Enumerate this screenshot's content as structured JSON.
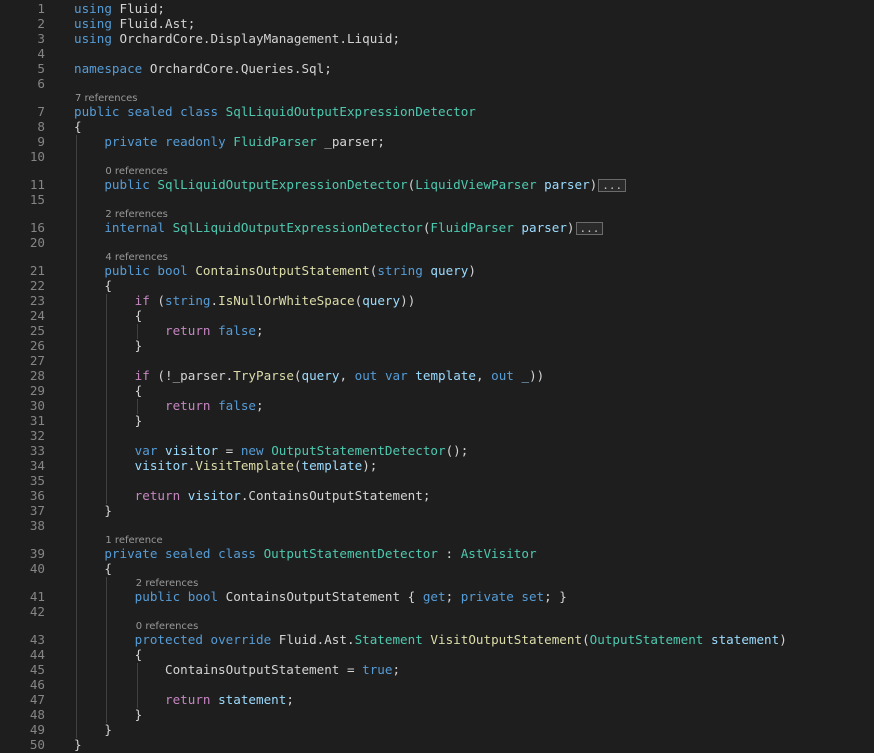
{
  "editor": {
    "gutter_icons": {
      "line1": "{}",
      "line39": "◉↑",
      "line43": "◉↑"
    },
    "lines": [
      {
        "n": "1",
        "segs": [
          [
            "kw",
            "using"
          ],
          [
            "txt",
            " Fluid;"
          ]
        ]
      },
      {
        "n": "2",
        "segs": [
          [
            "kw",
            "using"
          ],
          [
            "txt",
            " Fluid.Ast;"
          ]
        ]
      },
      {
        "n": "3",
        "segs": [
          [
            "kw",
            "using"
          ],
          [
            "txt",
            " OrchardCore.DisplayManagement.Liquid;"
          ]
        ]
      },
      {
        "n": "4",
        "segs": []
      },
      {
        "n": "5",
        "segs": [
          [
            "kw",
            "namespace"
          ],
          [
            "txt",
            " OrchardCore.Queries.Sql;"
          ]
        ]
      },
      {
        "n": "6",
        "segs": []
      },
      {
        "n": "7",
        "lens": "7 references",
        "segs": [
          [
            "kw",
            "public sealed class "
          ],
          [
            "ty",
            "SqlLiquidOutputExpressionDetector"
          ]
        ]
      },
      {
        "n": "8",
        "segs": [
          [
            "txt",
            "{"
          ]
        ]
      },
      {
        "n": "9",
        "segs": [
          [
            "txt",
            "    "
          ],
          [
            "kw",
            "private readonly "
          ],
          [
            "ty",
            "FluidParser"
          ],
          [
            "txt",
            " _parser;"
          ]
        ]
      },
      {
        "n": "10",
        "segs": []
      },
      {
        "n": "11",
        "lens": "0 references",
        "fold": "›",
        "segs": [
          [
            "txt",
            "    "
          ],
          [
            "kw",
            "public "
          ],
          [
            "ty",
            "SqlLiquidOutputExpressionDetector"
          ],
          [
            "txt",
            "("
          ],
          [
            "ty",
            "LiquidViewParser"
          ],
          [
            "txt",
            " "
          ],
          [
            "var",
            "parser"
          ],
          [
            "txt",
            ")"
          ]
        ],
        "ellipsis": "..."
      },
      {
        "n": "15",
        "segs": []
      },
      {
        "n": "16",
        "lens": "2 references",
        "fold": "›",
        "segs": [
          [
            "txt",
            "    "
          ],
          [
            "kw",
            "internal "
          ],
          [
            "ty",
            "SqlLiquidOutputExpressionDetector"
          ],
          [
            "txt",
            "("
          ],
          [
            "ty",
            "FluidParser"
          ],
          [
            "txt",
            " "
          ],
          [
            "var",
            "parser"
          ],
          [
            "txt",
            ")"
          ]
        ],
        "ellipsis": "..."
      },
      {
        "n": "20",
        "segs": []
      },
      {
        "n": "21",
        "lens": "4 references",
        "segs": [
          [
            "txt",
            "    "
          ],
          [
            "kw",
            "public bool "
          ],
          [
            "fn",
            "ContainsOutputStatement"
          ],
          [
            "txt",
            "("
          ],
          [
            "kw",
            "string"
          ],
          [
            "txt",
            " "
          ],
          [
            "var",
            "query"
          ],
          [
            "txt",
            ")"
          ]
        ]
      },
      {
        "n": "22",
        "segs": [
          [
            "txt",
            "    {"
          ]
        ]
      },
      {
        "n": "23",
        "segs": [
          [
            "txt",
            "        "
          ],
          [
            "ctl",
            "if"
          ],
          [
            "txt",
            " ("
          ],
          [
            "kw",
            "string"
          ],
          [
            "txt",
            "."
          ],
          [
            "fn",
            "IsNullOrWhiteSpace"
          ],
          [
            "txt",
            "("
          ],
          [
            "var",
            "query"
          ],
          [
            "txt",
            "))"
          ]
        ]
      },
      {
        "n": "24",
        "segs": [
          [
            "txt",
            "        {"
          ]
        ]
      },
      {
        "n": "25",
        "segs": [
          [
            "txt",
            "            "
          ],
          [
            "ctl",
            "return"
          ],
          [
            "txt",
            " "
          ],
          [
            "kw",
            "false"
          ],
          [
            "txt",
            ";"
          ]
        ]
      },
      {
        "n": "26",
        "segs": [
          [
            "txt",
            "        }"
          ]
        ]
      },
      {
        "n": "27",
        "segs": []
      },
      {
        "n": "28",
        "segs": [
          [
            "txt",
            "        "
          ],
          [
            "ctl",
            "if"
          ],
          [
            "txt",
            " (!_parser."
          ],
          [
            "fn",
            "TryParse"
          ],
          [
            "txt",
            "("
          ],
          [
            "var",
            "query"
          ],
          [
            "txt",
            ", "
          ],
          [
            "kw",
            "out var"
          ],
          [
            "txt",
            " "
          ],
          [
            "var",
            "template"
          ],
          [
            "txt",
            ", "
          ],
          [
            "kw",
            "out"
          ],
          [
            "txt",
            " "
          ],
          [
            "var",
            "_"
          ],
          [
            "txt",
            "))"
          ]
        ]
      },
      {
        "n": "29",
        "segs": [
          [
            "txt",
            "        {"
          ]
        ]
      },
      {
        "n": "30",
        "segs": [
          [
            "txt",
            "            "
          ],
          [
            "ctl",
            "return"
          ],
          [
            "txt",
            " "
          ],
          [
            "kw",
            "false"
          ],
          [
            "txt",
            ";"
          ]
        ]
      },
      {
        "n": "31",
        "segs": [
          [
            "txt",
            "        }"
          ]
        ]
      },
      {
        "n": "32",
        "segs": []
      },
      {
        "n": "33",
        "segs": [
          [
            "txt",
            "        "
          ],
          [
            "kw",
            "var"
          ],
          [
            "txt",
            " "
          ],
          [
            "var",
            "visitor"
          ],
          [
            "txt",
            " = "
          ],
          [
            "kw",
            "new"
          ],
          [
            "txt",
            " "
          ],
          [
            "ty",
            "OutputStatementDetector"
          ],
          [
            "txt",
            "();"
          ]
        ]
      },
      {
        "n": "34",
        "segs": [
          [
            "txt",
            "        "
          ],
          [
            "var",
            "visitor"
          ],
          [
            "txt",
            "."
          ],
          [
            "fn",
            "VisitTemplate"
          ],
          [
            "txt",
            "("
          ],
          [
            "var",
            "template"
          ],
          [
            "txt",
            ");"
          ]
        ]
      },
      {
        "n": "35",
        "segs": []
      },
      {
        "n": "36",
        "segs": [
          [
            "txt",
            "        "
          ],
          [
            "ctl",
            "return"
          ],
          [
            "txt",
            " "
          ],
          [
            "var",
            "visitor"
          ],
          [
            "txt",
            ".ContainsOutputStatement;"
          ]
        ]
      },
      {
        "n": "37",
        "segs": [
          [
            "txt",
            "    }"
          ]
        ]
      },
      {
        "n": "38",
        "segs": []
      },
      {
        "n": "39",
        "lens": "1 reference",
        "icon": "line39",
        "segs": [
          [
            "txt",
            "    "
          ],
          [
            "kw",
            "private sealed class "
          ],
          [
            "ty",
            "OutputStatementDetector"
          ],
          [
            "txt",
            " : "
          ],
          [
            "ty",
            "AstVisitor"
          ]
        ]
      },
      {
        "n": "40",
        "segs": [
          [
            "txt",
            "    {"
          ]
        ]
      },
      {
        "n": "41",
        "lens": "2 references",
        "segs": [
          [
            "txt",
            "        "
          ],
          [
            "kw",
            "public bool "
          ],
          [
            "txt",
            "ContainsOutputStatement { "
          ],
          [
            "kw",
            "get"
          ],
          [
            "txt",
            "; "
          ],
          [
            "kw",
            "private set"
          ],
          [
            "txt",
            "; }"
          ]
        ]
      },
      {
        "n": "42",
        "segs": []
      },
      {
        "n": "43",
        "lens": "0 references",
        "icon": "line43",
        "segs": [
          [
            "txt",
            "        "
          ],
          [
            "kw",
            "protected override "
          ],
          [
            "txt",
            "Fluid.Ast."
          ],
          [
            "ty",
            "Statement"
          ],
          [
            "txt",
            " "
          ],
          [
            "fn",
            "VisitOutputStatement"
          ],
          [
            "txt",
            "("
          ],
          [
            "ty",
            "OutputStatement"
          ],
          [
            "txt",
            " "
          ],
          [
            "var",
            "statement"
          ],
          [
            "txt",
            ")"
          ]
        ]
      },
      {
        "n": "44",
        "segs": [
          [
            "txt",
            "        {"
          ]
        ]
      },
      {
        "n": "45",
        "segs": [
          [
            "txt",
            "            ContainsOutputStatement = "
          ],
          [
            "kw",
            "true"
          ],
          [
            "txt",
            ";"
          ]
        ]
      },
      {
        "n": "46",
        "segs": []
      },
      {
        "n": "47",
        "segs": [
          [
            "txt",
            "            "
          ],
          [
            "ctl",
            "return"
          ],
          [
            "txt",
            " "
          ],
          [
            "var",
            "statement"
          ],
          [
            "txt",
            ";"
          ]
        ]
      },
      {
        "n": "48",
        "segs": [
          [
            "txt",
            "        }"
          ]
        ]
      },
      {
        "n": "49",
        "segs": [
          [
            "txt",
            "    }"
          ]
        ]
      },
      {
        "n": "50",
        "segs": [
          [
            "txt",
            "}"
          ]
        ]
      }
    ]
  }
}
